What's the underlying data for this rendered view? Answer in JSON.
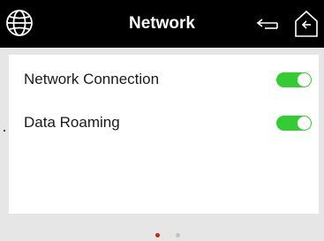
{
  "header": {
    "title": "Network",
    "icons": {
      "left": "globe-icon",
      "back": "back-arrow-icon",
      "home": "home-icon"
    }
  },
  "settings": [
    {
      "label": "Network Connection",
      "enabled": true
    },
    {
      "label": "Data Roaming",
      "enabled": true
    }
  ],
  "pagination": {
    "pages": 2,
    "current": 1
  },
  "colors": {
    "header_bg": "#000000",
    "toggle_on": "#33cc33",
    "active_dot": "#d62020",
    "inactive_dot": "#c4c4c4",
    "background": "#e6e6e6"
  }
}
